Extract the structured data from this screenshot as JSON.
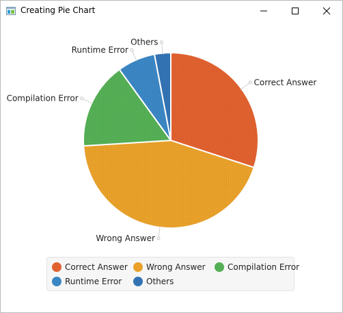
{
  "window": {
    "title": "Creating Pie Chart",
    "icon": "app-window-icon",
    "controls": [
      "minimize-icon",
      "maximize-icon",
      "close-icon"
    ]
  },
  "chart_data": {
    "type": "pie",
    "title": "",
    "start_angle_degrees": 90,
    "direction": "clockwise",
    "slices": [
      {
        "label": "Correct Answer",
        "value": 30,
        "color": "#e0612f"
      },
      {
        "label": "Wrong Answer",
        "value": 44,
        "color": "#e9a12a"
      },
      {
        "label": "Compilation Error",
        "value": 16,
        "color": "#55af55"
      },
      {
        "label": "Runtime Error",
        "value": 7,
        "color": "#3b86c4"
      },
      {
        "label": "Others",
        "value": 3,
        "color": "#3373b4"
      }
    ],
    "legend_position": "bottom"
  }
}
